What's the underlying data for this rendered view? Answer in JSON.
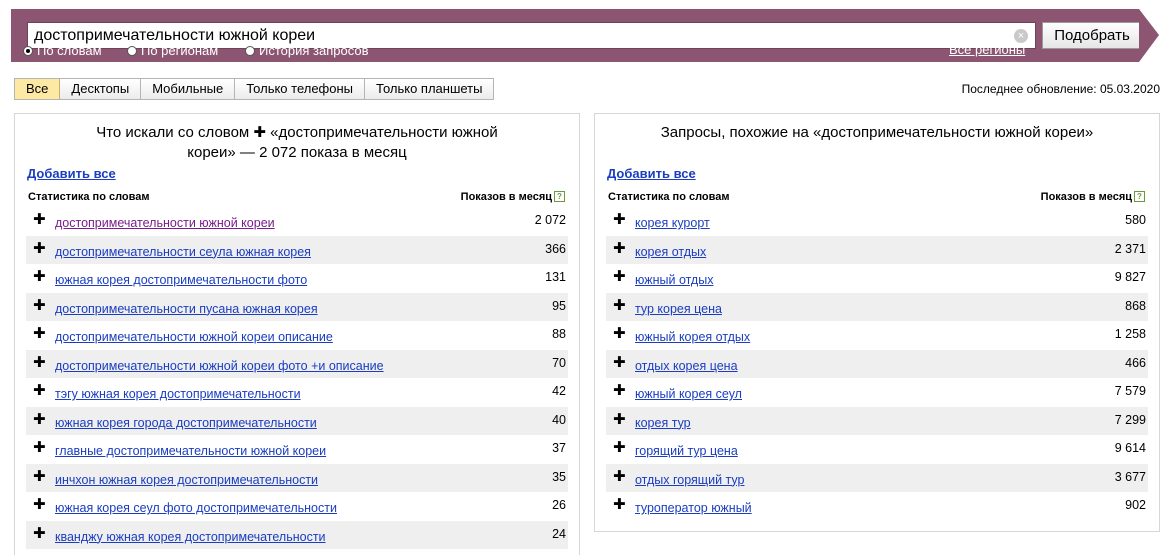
{
  "search": {
    "query": "достопримечательности южной кореи",
    "submit_label": "Подобрать",
    "clear_icon": "close-icon"
  },
  "modes": [
    {
      "label": "По словам",
      "checked": true
    },
    {
      "label": "По регионам",
      "checked": false
    },
    {
      "label": "История запросов",
      "checked": false
    }
  ],
  "regions_link": "Все регионы",
  "device_tabs": [
    {
      "label": "Все",
      "active": true
    },
    {
      "label": "Десктопы",
      "active": false
    },
    {
      "label": "Мобильные",
      "active": false
    },
    {
      "label": "Только телефоны",
      "active": false
    },
    {
      "label": "Только планшеты",
      "active": false
    }
  ],
  "last_update": "Последнее обновление: 05.03.2020",
  "left_panel": {
    "title_pre": "Что искали со словом",
    "title_post": "«достопримечательности южной",
    "title_line2": "кореи» — 2 072 показа в месяц",
    "add_all": "Добавить все",
    "col_words": "Статистика по словам",
    "col_shows": "Показов в месяц",
    "rows": [
      {
        "phrase": "достопримечательности южной кореи",
        "count": "2 072",
        "visited": true
      },
      {
        "phrase": "достопримечательности сеула южная корея",
        "count": "366",
        "visited": false
      },
      {
        "phrase": "южная корея достопримечательности фото",
        "count": "131",
        "visited": false
      },
      {
        "phrase": "достопримечательности пусана южная корея",
        "count": "95",
        "visited": false
      },
      {
        "phrase": "достопримечательности южной кореи описание",
        "count": "88",
        "visited": false
      },
      {
        "phrase": "достопримечательности южной кореи фото +и описание",
        "count": "70",
        "visited": false
      },
      {
        "phrase": "тэгу южная корея достопримечательности",
        "count": "42",
        "visited": false
      },
      {
        "phrase": "южная корея города достопримечательности",
        "count": "40",
        "visited": false
      },
      {
        "phrase": "главные достопримечательности южной кореи",
        "count": "37",
        "visited": false
      },
      {
        "phrase": "инчхон южная корея достопримечательности",
        "count": "35",
        "visited": false
      },
      {
        "phrase": "южная корея сеул фото достопримечательности",
        "count": "26",
        "visited": false
      },
      {
        "phrase": "кванджу южная корея достопримечательности",
        "count": "24",
        "visited": false
      }
    ]
  },
  "right_panel": {
    "title": "Запросы, похожие на «достопримечательности южной кореи»",
    "add_all": "Добавить все",
    "col_words": "Статистика по словам",
    "col_shows": "Показов в месяц",
    "rows": [
      {
        "phrase": "корея курорт",
        "count": "580"
      },
      {
        "phrase": "корея отдых",
        "count": "2 371"
      },
      {
        "phrase": "южный отдых",
        "count": "9 827"
      },
      {
        "phrase": "тур корея цена",
        "count": "868"
      },
      {
        "phrase": "южный корея отдых",
        "count": "1 258"
      },
      {
        "phrase": "отдых корея цена",
        "count": "466"
      },
      {
        "phrase": "южный корея сеул",
        "count": "7 579"
      },
      {
        "phrase": "корея тур",
        "count": "7 299"
      },
      {
        "phrase": "горящий тур цена",
        "count": "9 614"
      },
      {
        "phrase": "отдых горящий тур",
        "count": "3 677"
      },
      {
        "phrase": "туроператор южный",
        "count": "902"
      }
    ]
  },
  "help_mark": "?",
  "plus_mark": "✚"
}
